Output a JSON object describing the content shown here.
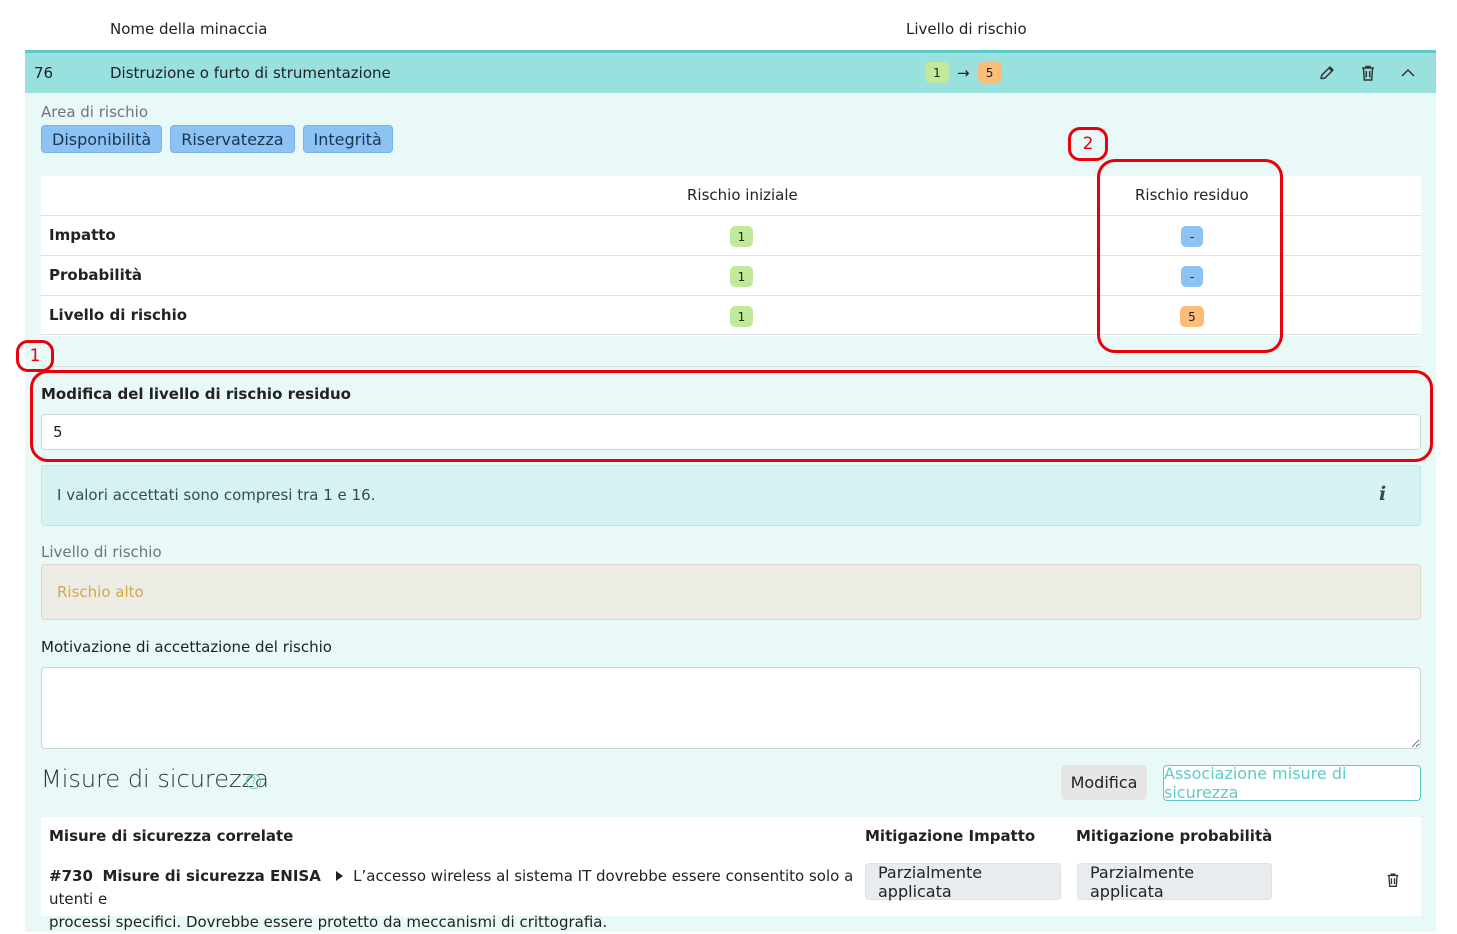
{
  "table_header": {
    "name_col": "Nome della minaccia",
    "level_col": "Livello di rischio"
  },
  "threat": {
    "id": "76",
    "name": "Distruzione o furto di strumentazione",
    "level_from": "1",
    "arrow": "→",
    "level_to": "5"
  },
  "risk_area": {
    "label": "Area di rischio",
    "chips": [
      "Disponibilità",
      "Riservatezza",
      "Integrità"
    ]
  },
  "risk_table": {
    "col_initial": "Rischio iniziale",
    "col_residual": "Rischio residuo",
    "rows": [
      {
        "label": "Impatto",
        "initial": "1",
        "residual": "-"
      },
      {
        "label": "Probabilità",
        "initial": "1",
        "residual": "-"
      },
      {
        "label": "Livello di rischio",
        "initial": "1",
        "residual": "5"
      }
    ]
  },
  "annotations": {
    "one": "1",
    "two": "2"
  },
  "residual_edit": {
    "label": "Modifica del livello di rischio residuo",
    "value": "5"
  },
  "info": {
    "text": "I valori accettati sono compresi tra 1 e 16.",
    "icon_glyph": "i"
  },
  "risk_level": {
    "label": "Livello di rischio",
    "value": "Rischio alto"
  },
  "motivation": {
    "label": "Motivazione di accettazione del rischio",
    "value": ""
  },
  "measures_section": {
    "title": "Misure di sicurezza",
    "help_glyph": "?",
    "edit_button": "Modifica",
    "associate_button": "Associazione misure di sicurezza",
    "col_related": "Misure di sicurezza correlate",
    "col_impact": "Mitigazione Impatto",
    "col_probability": "Mitigazione probabilità",
    "item": {
      "code": "#730",
      "source": "Misure di sicurezza ENISA",
      "description_line1": "L’accesso wireless al sistema IT dovrebbe essere consentito solo a utenti e",
      "description_line2": "processi specifici. Dovrebbe essere protetto da meccanismi di crittografia.",
      "impact_value": "Parzialmente applicata",
      "probability_value": "Parzialmente applicata"
    }
  },
  "colors": {
    "threat_row": "#99e1df",
    "panel": "#e9f9f7",
    "badge_green": "#c2e89a",
    "badge_orange": "#fbbd78",
    "badge_blue": "#8dc2f5",
    "annotation_red": "#e8000b",
    "accent_teal": "#5ccbc7"
  },
  "icons": [
    "pencil-icon",
    "trash-icon",
    "chevron-up-icon",
    "info-icon",
    "help-circle-icon",
    "caret-right-icon"
  ]
}
